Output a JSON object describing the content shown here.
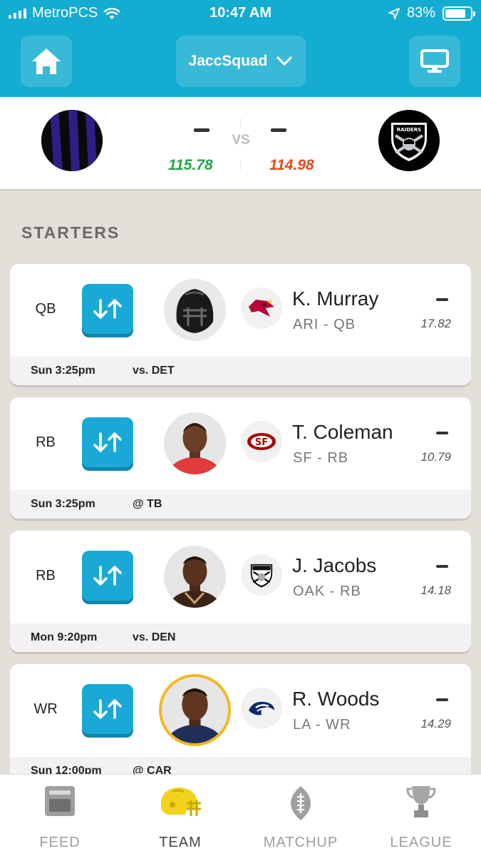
{
  "status_bar": {
    "carrier": "MetroPCS",
    "time": "10:47 AM",
    "battery": "83%",
    "battery_level": 0.83
  },
  "header": {
    "team_selector": "JaccSquad"
  },
  "matchup": {
    "left_score_dash": "–",
    "right_score_dash": "–",
    "vs": "VS",
    "left_projected": "115.78",
    "right_projected": "114.98",
    "colors": {
      "left": "#1fa843",
      "right": "#e2491e"
    }
  },
  "section_title": "STARTERS",
  "players": [
    {
      "pos": "QB",
      "name": "K. Murray",
      "team": "ARI - QB",
      "team_logo": "cardinal-icon",
      "points": "–",
      "projected": "17.82",
      "game_time": "Sun 3:25pm",
      "opponent": "vs. DET"
    },
    {
      "pos": "RB",
      "name": "T. Coleman",
      "team": "SF - RB",
      "team_logo": "sf-49ers-icon",
      "points": "–",
      "projected": "10.79",
      "game_time": "Sun 3:25pm",
      "opponent": "@ TB"
    },
    {
      "pos": "RB",
      "name": "J. Jacobs",
      "team": "OAK - RB",
      "team_logo": "raiders-shield-icon",
      "points": "–",
      "projected": "14.18",
      "game_time": "Mon 9:20pm",
      "opponent": "vs. DEN"
    },
    {
      "pos": "WR",
      "name": "R. Woods",
      "team": "LA - WR",
      "team_logo": "rams-horn-icon",
      "points": "–",
      "projected": "14.29",
      "game_time": "Sun 12:00pm",
      "opponent": "@ CAR"
    }
  ],
  "tabs": [
    {
      "label": "FEED",
      "icon": "feed-icon"
    },
    {
      "label": "TEAM",
      "icon": "helmet-icon"
    },
    {
      "label": "MATCHUP",
      "icon": "football-icon"
    },
    {
      "label": "LEAGUE",
      "icon": "trophy-icon"
    }
  ],
  "accent_color": "#14acd1"
}
